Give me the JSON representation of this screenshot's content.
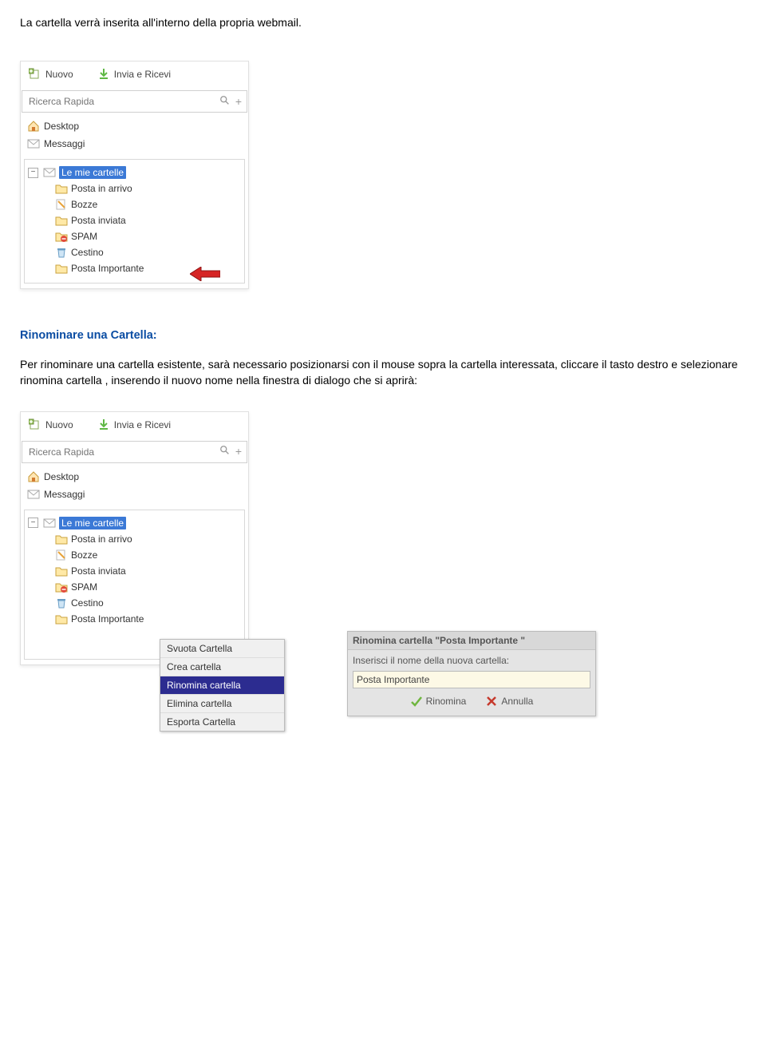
{
  "intro_text": "La cartella verrà inserita all'interno della propria webmail.",
  "toolbar": {
    "nuovo": "Nuovo",
    "invia_ricevi": "Invia e Ricevi"
  },
  "search_placeholder": "Ricerca Rapida",
  "nav": {
    "desktop": "Desktop",
    "messaggi": "Messaggi"
  },
  "tree": {
    "root": "Le mie cartelle",
    "items": [
      "Posta in arrivo",
      "Bozze",
      "Posta inviata",
      "SPAM",
      "Cestino",
      "Posta Importante"
    ]
  },
  "section_title": "Rinominare una Cartella:",
  "paragraph_text": "Per rinominare una cartella esistente, sarà necessario posizionarsi con il mouse sopra la cartella interessata, cliccare il tasto destro e selezionare rinomina cartella , inserendo il nuovo nome nella finestra di dialogo che si aprirà:",
  "context_menu": [
    "Svuota Cartella",
    "Crea cartella",
    "Rinomina cartella",
    "Elimina cartella",
    "Esporta Cartella"
  ],
  "rename_dialog": {
    "title": "Rinomina cartella \"Posta Importante \"",
    "prompt": "Inserisci il nome della nuova cartella:",
    "value": "Posta Importante",
    "rinomina": "Rinomina",
    "annulla": "Annulla"
  }
}
